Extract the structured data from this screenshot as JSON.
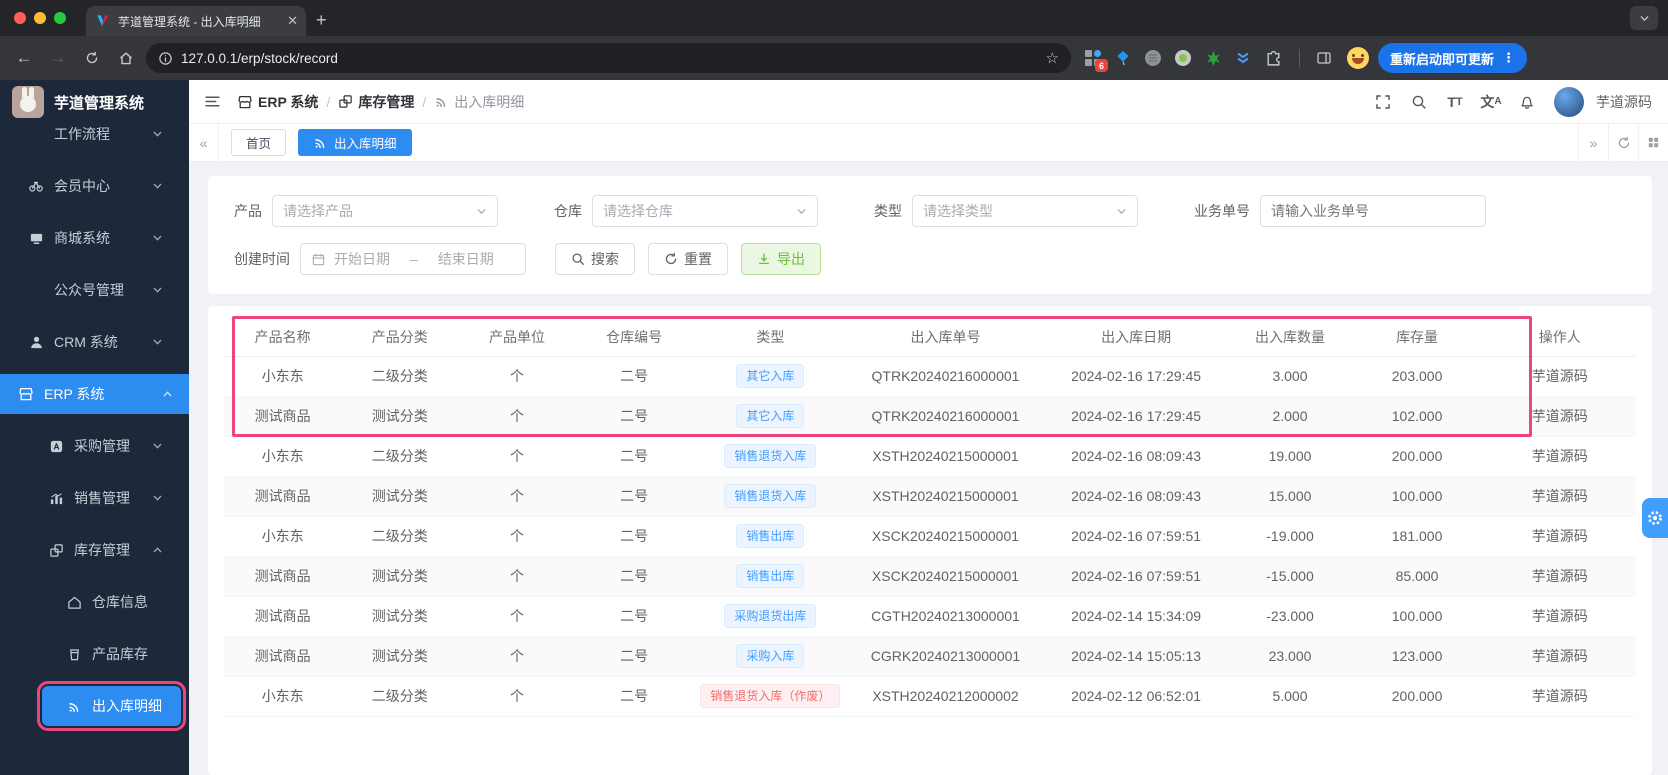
{
  "colors": {
    "accent": "#2d8cf0",
    "tag_blue": "#409eff",
    "success": "#67c23a",
    "danger": "#f56c6c",
    "annotation": "#ec4581",
    "sidebar_bg": "#1d293b"
  },
  "browser": {
    "tab_title": "芋道管理系统 - 出入库明细",
    "url": "127.0.0.1/erp/stock/record",
    "update_button": "重新启动即可更新",
    "extension_badge": "6"
  },
  "sidebar": {
    "logo_title": "芋道管理系统",
    "menu": [
      {
        "label": "工作流程",
        "icon": "",
        "level": 1,
        "chevron": "down",
        "clipped": true
      },
      {
        "label": "会员中心",
        "icon": "member",
        "level": 1,
        "chevron": "down"
      },
      {
        "label": "商城系统",
        "icon": "mall",
        "level": 1,
        "chevron": "down"
      },
      {
        "label": "公众号管理",
        "icon": "",
        "level": 1,
        "chevron": "down"
      },
      {
        "label": "CRM 系统",
        "icon": "crm",
        "level": 1,
        "chevron": "down"
      },
      {
        "label": "ERP 系统",
        "icon": "erp",
        "level": 1,
        "chevron": "up",
        "active": true,
        "full": true
      },
      {
        "label": "采购管理",
        "icon": "purchase",
        "level": 2,
        "chevron": "down"
      },
      {
        "label": "销售管理",
        "icon": "sales",
        "level": 2,
        "chevron": "down"
      },
      {
        "label": "库存管理",
        "icon": "stock",
        "level": 2,
        "chevron": "up"
      },
      {
        "label": "仓库信息",
        "icon": "warehouse",
        "level": 3
      },
      {
        "label": "产品库存",
        "icon": "product",
        "level": 3
      },
      {
        "label": "出入库明细",
        "icon": "record",
        "level": 3,
        "active": true,
        "annotated": true
      }
    ]
  },
  "header": {
    "breadcrumb": [
      {
        "label": "ERP 系统",
        "icon": "erp"
      },
      {
        "label": "库存管理",
        "icon": "stock"
      },
      {
        "label": "出入库明细",
        "icon": "record"
      }
    ],
    "username": "芋道源码"
  },
  "tabs": {
    "items": [
      {
        "label": "首页",
        "active": false
      },
      {
        "label": "出入库明细",
        "active": true,
        "icon": "record"
      }
    ]
  },
  "filters": {
    "product_label": "产品",
    "product_placeholder": "请选择产品",
    "warehouse_label": "仓库",
    "warehouse_placeholder": "请选择仓库",
    "type_label": "类型",
    "type_placeholder": "请选择类型",
    "bizno_label": "业务单号",
    "bizno_placeholder": "请输入业务单号",
    "created_label": "创建时间",
    "date_start_placeholder": "开始日期",
    "date_range_separator": "–",
    "date_end_placeholder": "结束日期",
    "search_label": "搜索",
    "reset_label": "重置",
    "export_label": "导出"
  },
  "table": {
    "columns": [
      "产品名称",
      "产品分类",
      "产品单位",
      "仓库编号",
      "类型",
      "出入库单号",
      "出入库日期",
      "出入库数量",
      "库存量",
      "操作人"
    ],
    "rows": [
      {
        "product": "小东东",
        "category": "二级分类",
        "unit": "个",
        "warehouse": "二号",
        "type": "其它入库",
        "tag": "blue",
        "order_no": "QTRK20240216000001",
        "date": "2024-02-16 17:29:45",
        "quantity": "3.000",
        "stock": "203.000",
        "operator": "芋道源码"
      },
      {
        "product": "测试商品",
        "category": "测试分类",
        "unit": "个",
        "warehouse": "二号",
        "type": "其它入库",
        "tag": "blue",
        "order_no": "QTRK20240216000001",
        "date": "2024-02-16 17:29:45",
        "quantity": "2.000",
        "stock": "102.000",
        "operator": "芋道源码"
      },
      {
        "product": "小东东",
        "category": "二级分类",
        "unit": "个",
        "warehouse": "二号",
        "type": "销售退货入库",
        "tag": "blue",
        "order_no": "XSTH20240215000001",
        "date": "2024-02-16 08:09:43",
        "quantity": "19.000",
        "stock": "200.000",
        "operator": "芋道源码"
      },
      {
        "product": "测试商品",
        "category": "测试分类",
        "unit": "个",
        "warehouse": "二号",
        "type": "销售退货入库",
        "tag": "blue",
        "order_no": "XSTH20240215000001",
        "date": "2024-02-16 08:09:43",
        "quantity": "15.000",
        "stock": "100.000",
        "operator": "芋道源码"
      },
      {
        "product": "小东东",
        "category": "二级分类",
        "unit": "个",
        "warehouse": "二号",
        "type": "销售出库",
        "tag": "blue",
        "order_no": "XSCK20240215000001",
        "date": "2024-02-16 07:59:51",
        "quantity": "-19.000",
        "stock": "181.000",
        "operator": "芋道源码"
      },
      {
        "product": "测试商品",
        "category": "测试分类",
        "unit": "个",
        "warehouse": "二号",
        "type": "销售出库",
        "tag": "blue",
        "order_no": "XSCK20240215000001",
        "date": "2024-02-16 07:59:51",
        "quantity": "-15.000",
        "stock": "85.000",
        "operator": "芋道源码"
      },
      {
        "product": "测试商品",
        "category": "测试分类",
        "unit": "个",
        "warehouse": "二号",
        "type": "采购退货出库",
        "tag": "blue",
        "order_no": "CGTH20240213000001",
        "date": "2024-02-14 15:34:09",
        "quantity": "-23.000",
        "stock": "100.000",
        "operator": "芋道源码"
      },
      {
        "product": "测试商品",
        "category": "测试分类",
        "unit": "个",
        "warehouse": "二号",
        "type": "采购入库",
        "tag": "blue",
        "order_no": "CGRK20240213000001",
        "date": "2024-02-14 15:05:13",
        "quantity": "23.000",
        "stock": "123.000",
        "operator": "芋道源码"
      },
      {
        "product": "小东东",
        "category": "二级分类",
        "unit": "个",
        "warehouse": "二号",
        "type": "销售退货入库（作废）",
        "tag": "red",
        "order_no": "XSTH20240212000002",
        "date": "2024-02-12 06:52:01",
        "quantity": "5.000",
        "stock": "200.000",
        "operator": "芋道源码"
      }
    ]
  }
}
